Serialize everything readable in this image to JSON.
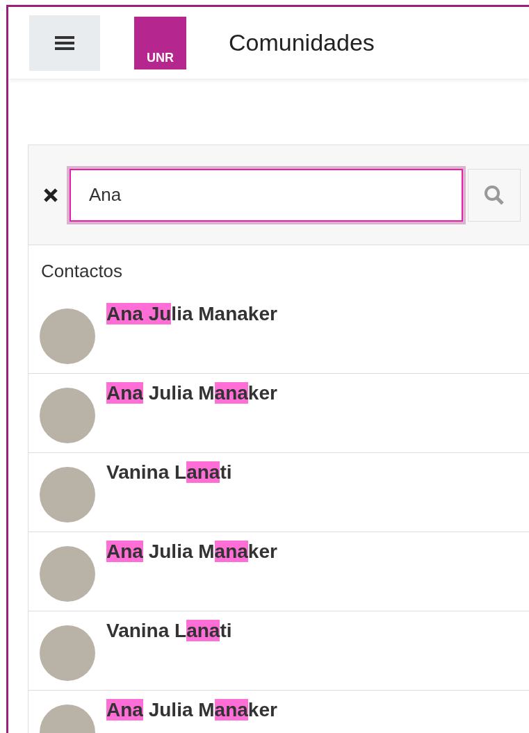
{
  "header": {
    "logo_text": "UNR",
    "title": "Comunidades"
  },
  "search": {
    "value": "Ana"
  },
  "section_title": "Contactos",
  "contacts": [
    {
      "name": [
        {
          "text": "Ana Ju",
          "highlight": true
        },
        {
          "text": "lia Manaker",
          "highlight": false
        }
      ]
    },
    {
      "name": [
        {
          "text": "Ana",
          "highlight": true
        },
        {
          "text": " Julia M",
          "highlight": false
        },
        {
          "text": "ana",
          "highlight": true
        },
        {
          "text": "ker",
          "highlight": false
        }
      ]
    },
    {
      "name": [
        {
          "text": "Vanina L",
          "highlight": false
        },
        {
          "text": "ana",
          "highlight": true
        },
        {
          "text": "ti",
          "highlight": false
        }
      ]
    },
    {
      "name": [
        {
          "text": "Ana",
          "highlight": true
        },
        {
          "text": " Julia M",
          "highlight": false
        },
        {
          "text": "ana",
          "highlight": true
        },
        {
          "text": "ker",
          "highlight": false
        }
      ]
    },
    {
      "name": [
        {
          "text": "Vanina L",
          "highlight": false
        },
        {
          "text": "ana",
          "highlight": true
        },
        {
          "text": "ti",
          "highlight": false
        }
      ]
    },
    {
      "name": [
        {
          "text": "Ana",
          "highlight": true
        },
        {
          "text": " Julia M",
          "highlight": false
        },
        {
          "text": "ana",
          "highlight": true
        },
        {
          "text": "ker",
          "highlight": false
        }
      ]
    }
  ]
}
